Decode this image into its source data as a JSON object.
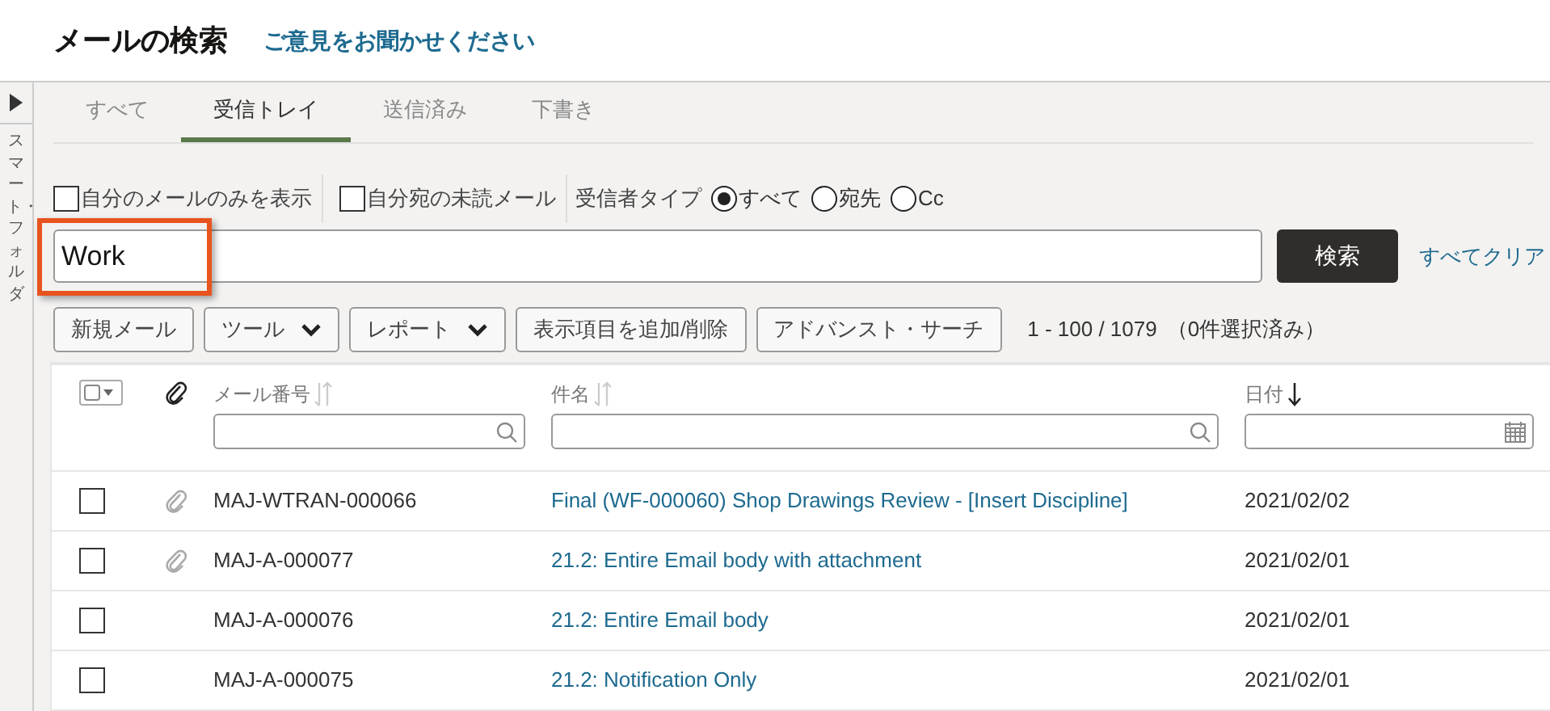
{
  "page": {
    "title": "メールの検索",
    "feedback_link": "ご意見をお聞かせください"
  },
  "sidebar": {
    "label": "スマート・フォルダ"
  },
  "tabs": [
    {
      "label": "すべて",
      "selected": false
    },
    {
      "label": "受信トレイ",
      "selected": true
    },
    {
      "label": "送信済み",
      "selected": false
    },
    {
      "label": "下書き",
      "selected": false
    }
  ],
  "filters": {
    "checkboxes": [
      {
        "label": "自分のメールのみを表示",
        "checked": false
      },
      {
        "label": "自分宛の未読メール",
        "checked": false
      }
    ],
    "recipient_type": {
      "label": "受信者タイプ",
      "options": [
        {
          "label": "すべて",
          "selected": true
        },
        {
          "label": "宛先",
          "selected": false
        },
        {
          "label": "Cc",
          "selected": false
        }
      ]
    }
  },
  "search": {
    "value": "Work",
    "button": "検索",
    "clear_link": "すべてクリア"
  },
  "toolbar": {
    "buttons": [
      {
        "label": "新規メール",
        "kind": "plain"
      },
      {
        "label": "ツール",
        "kind": "menu"
      },
      {
        "label": "レポート",
        "kind": "menu"
      },
      {
        "label": "表示項目を追加/削除",
        "kind": "plain"
      },
      {
        "label": "アドバンスト・サーチ",
        "kind": "plain"
      }
    ],
    "count": "1 - 100 / 1079",
    "selection": "（0件選択済み）"
  },
  "table": {
    "columns": [
      {
        "label": "メール番号",
        "sorted": false,
        "kind": "text"
      },
      {
        "label": "件名",
        "sorted": false,
        "kind": "text"
      },
      {
        "label": "日付",
        "sorted": true,
        "kind": "date"
      }
    ],
    "rows": [
      {
        "checked": false,
        "attachment": true,
        "number": "MAJ-WTRAN-000066",
        "subject": "Final (WF-000060) Shop Drawings Review - [Insert Discipline]",
        "date": "2021/02/02"
      },
      {
        "checked": false,
        "attachment": true,
        "number": "MAJ-A-000077",
        "subject": "21.2: Entire Email body with attachment",
        "date": "2021/02/01"
      },
      {
        "checked": false,
        "attachment": false,
        "number": "MAJ-A-000076",
        "subject": "21.2: Entire Email body",
        "date": "2021/02/01"
      },
      {
        "checked": false,
        "attachment": false,
        "number": "MAJ-A-000075",
        "subject": "21.2: Notification Only",
        "date": "2021/02/01"
      }
    ]
  },
  "highlight": {
    "on": true
  }
}
